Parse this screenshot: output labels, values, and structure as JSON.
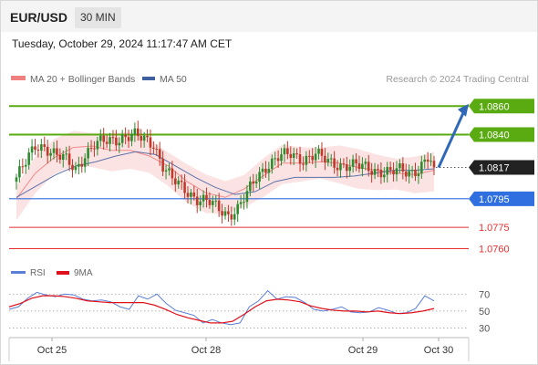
{
  "header": {
    "symbol": "EUR/USD",
    "timeframe": "30 MIN",
    "datetime": "Tuesday, October 29, 2024 11:17:47 AM CET"
  },
  "legend": {
    "ma20_label": "MA 20 + Bollinger Bands",
    "ma50_label": "MA 50",
    "credit": "Research © 2024 Trading Central",
    "ma20_color": "#f08080",
    "ma50_color": "#3f5f9f"
  },
  "rsi_legend": {
    "rsi_label": "RSI",
    "ma_label": "9MA",
    "rsi_color": "#5b7fd6",
    "ma_color": "#e0101a"
  },
  "colors": {
    "bull": "#2e8b2e",
    "bear": "#c0392b",
    "target": "#5aab12",
    "pivot": "#2f6fe0",
    "support": "#e53030",
    "arrow": "#3068b8",
    "last": "#222222"
  },
  "chart_data": [
    {
      "type": "candlestick",
      "x_labels": [
        "Oct 25",
        "Oct 28",
        "Oct 29",
        "Oct 30"
      ],
      "y_range": [
        1.0752,
        1.0873
      ],
      "series": [
        {
          "name": "MA 20 + Bollinger Bands",
          "values": [
            1.0795,
            1.0813,
            1.0824,
            1.0831,
            1.0832,
            1.0829,
            1.0829,
            1.0825,
            1.0818,
            1.0807,
            1.0799,
            1.0796,
            1.0802,
            1.0811,
            1.082,
            1.082,
            1.0821,
            1.082,
            1.0817,
            1.0815,
            1.0813,
            1.0812,
            1.0815
          ]
        },
        {
          "name": "MA 50",
          "values": [
            1.0796,
            1.0804,
            1.0812,
            1.0818,
            1.0821,
            1.0825,
            1.0828,
            1.0826,
            1.0818,
            1.081,
            1.0803,
            1.0798,
            1.08,
            1.0807,
            1.081,
            1.081,
            1.081,
            1.0811,
            1.0813,
            1.0815,
            1.0815,
            1.0816
          ]
        }
      ],
      "levels": [
        {
          "label": "1.0860",
          "value": 1.086,
          "kind": "target"
        },
        {
          "label": "1.0840",
          "value": 1.084,
          "kind": "target"
        },
        {
          "label": "1.0817",
          "value": 1.0817,
          "kind": "last"
        },
        {
          "label": "1.0795",
          "value": 1.0795,
          "kind": "pivot"
        },
        {
          "label": "1.0775",
          "value": 1.0775,
          "kind": "support"
        },
        {
          "label": "1.0760",
          "value": 1.076,
          "kind": "support"
        }
      ]
    },
    {
      "type": "line",
      "title": "RSI",
      "y_ticks": [
        70,
        50,
        30
      ],
      "y_range": [
        23,
        80
      ],
      "series": [
        {
          "name": "RSI",
          "values": [
            52,
            55,
            65,
            72,
            69,
            67,
            70,
            69,
            64,
            62,
            63,
            61,
            55,
            52,
            68,
            64,
            70,
            59,
            51,
            48,
            45,
            36,
            40,
            36,
            34,
            36,
            55,
            62,
            74,
            64,
            67,
            66,
            60,
            52,
            50,
            52,
            55,
            49,
            48,
            49,
            54,
            51,
            47,
            48,
            53,
            68,
            62
          ]
        },
        {
          "name": "9MA",
          "values": [
            55,
            59,
            65,
            68,
            68,
            67,
            65,
            62,
            61,
            60,
            60,
            60,
            60,
            57,
            52,
            46,
            42,
            39,
            36,
            36,
            38,
            46,
            55,
            62,
            64,
            63,
            61,
            56,
            53,
            51,
            50,
            50,
            49,
            50,
            48,
            47,
            48,
            50,
            53
          ]
        }
      ]
    }
  ]
}
